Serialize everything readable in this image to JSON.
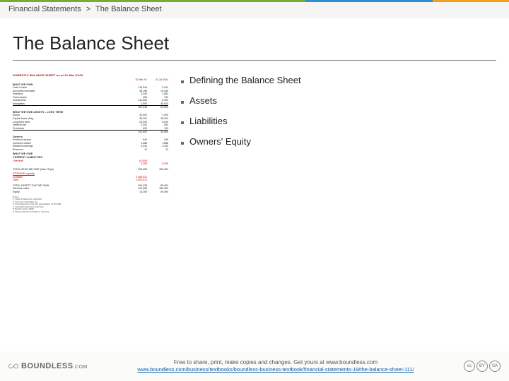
{
  "breadcrumb": {
    "root": "Financial Statements",
    "sep": ">",
    "current": "The Balance Sheet"
  },
  "title": "The Balance Sheet",
  "topics": [
    "Defining the Balance Sheet",
    "Assets",
    "Liabilities",
    "Owners' Equity"
  ],
  "footer": {
    "brand": "BOUNDLESS",
    "brand_suffix": ".COM",
    "tagline": "Free to share, print, make copies and changes. Get yours at www.boundless.com",
    "url": "www.boundless.com/business/textbooks/boundless-business-textbook/financial-statements-19/the-balance-sheet-111/",
    "cc": [
      "cc",
      "BY",
      "SA"
    ]
  },
  "thumb": {
    "title": "DOMESTIC BALANCE SHEET as at 31 Mar $'000",
    "cols": [
      "31 Mar XX",
      "31 Jul 2004"
    ]
  }
}
